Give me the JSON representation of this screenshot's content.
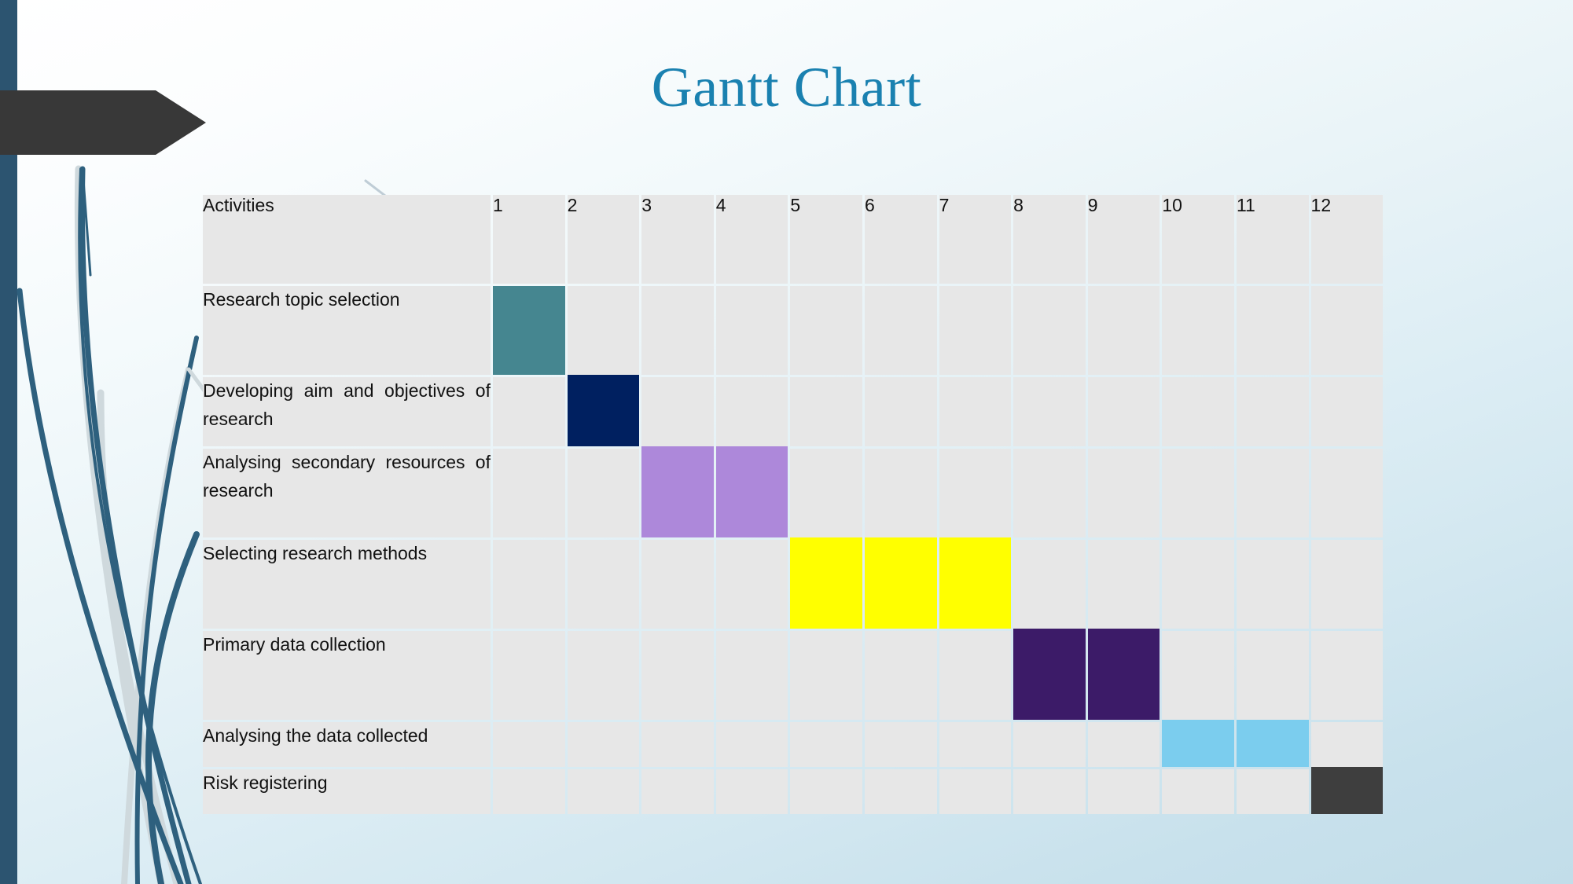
{
  "slide": {
    "title": "Gantt Chart",
    "title_color": "#1a81b0",
    "background_colors": {
      "top": "#ffffff",
      "bottom": "#c2dde9",
      "edge_stripe": "#2c5470",
      "arrow_banner": "#383838",
      "stem_dark": "#2e607e",
      "stem_light": "#cdd8dc"
    }
  },
  "table": {
    "activities_header": "Activities",
    "week_headers": [
      "1",
      "2",
      "3",
      "4",
      "5",
      "6",
      "7",
      "8",
      "9",
      "10",
      "11",
      "12"
    ],
    "cell_color": "#e7e7e7",
    "gridline_color": "#ffffff",
    "rows": [
      {
        "label": "Research topic selection",
        "start": 1,
        "span": 1,
        "color": "#458690"
      },
      {
        "label": "Developing aim and objectives of research",
        "start": 2,
        "span": 1,
        "color": "#002060"
      },
      {
        "label": "Analysing secondary resources of research",
        "start": 3,
        "span": 2,
        "color": "#ad88da"
      },
      {
        "label": "Selecting research methods",
        "start": 5,
        "span": 3,
        "color": "#ffff00"
      },
      {
        "label": "Primary data collection",
        "start": 8,
        "span": 2,
        "color": "#3c1b68"
      },
      {
        "label": "Analysing the data collected",
        "start": 10,
        "span": 2,
        "color": "#7bcdee"
      },
      {
        "label": "Risk registering",
        "start": 12,
        "span": 1,
        "color": "#3e3e3e"
      }
    ]
  },
  "chart_data": {
    "type": "bar",
    "title": "Gantt Chart",
    "xlabel": "",
    "ylabel": "Activities",
    "x": [
      1,
      2,
      3,
      4,
      5,
      6,
      7,
      8,
      9,
      10,
      11,
      12
    ],
    "categories": [
      "Research topic selection",
      "Developing aim and objectives of research",
      "Analysing secondary resources of research",
      "Selecting research methods",
      "Primary data collection",
      "Analysing the data collected",
      "Risk registering"
    ],
    "series": [
      {
        "name": "Research topic selection",
        "start": 1,
        "end": 1,
        "duration": 1,
        "color": "#458690"
      },
      {
        "name": "Developing aim and objectives of research",
        "start": 2,
        "end": 2,
        "duration": 1,
        "color": "#002060"
      },
      {
        "name": "Analysing secondary resources of research",
        "start": 3,
        "end": 4,
        "duration": 2,
        "color": "#ad88da"
      },
      {
        "name": "Selecting research methods",
        "start": 5,
        "end": 7,
        "duration": 3,
        "color": "#ffff00"
      },
      {
        "name": "Primary data collection",
        "start": 8,
        "end": 9,
        "duration": 2,
        "color": "#3c1b68"
      },
      {
        "name": "Analysing the data collected",
        "start": 10,
        "end": 11,
        "duration": 2,
        "color": "#7bcdee"
      },
      {
        "name": "Risk registering",
        "start": 12,
        "end": 12,
        "duration": 1,
        "color": "#3e3e3e"
      }
    ],
    "xlim": [
      1,
      12
    ],
    "grid": true,
    "legend": "none"
  }
}
